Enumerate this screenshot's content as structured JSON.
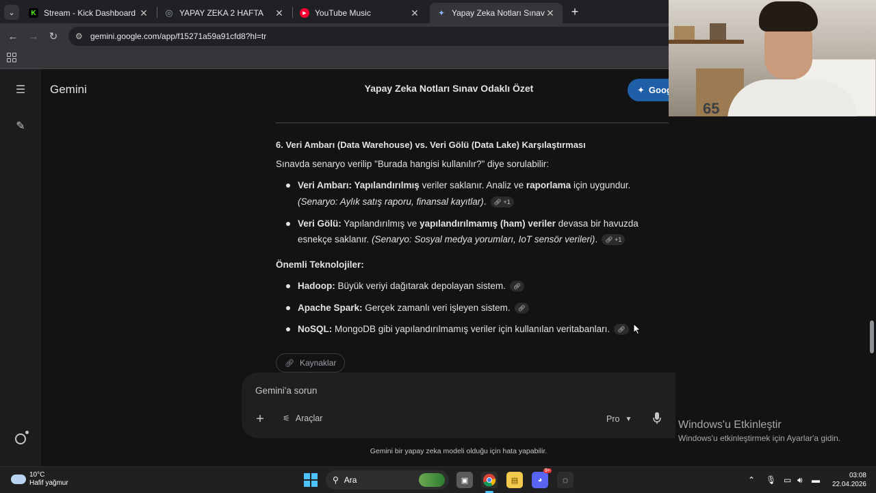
{
  "browser": {
    "tabs": [
      {
        "title": "Stream - Kick Dashboard",
        "favicon": "K",
        "favicon_color": "#53fc18",
        "active": false
      },
      {
        "title": "YAPAY ZEKA 2 HAFTA",
        "favicon": "◎",
        "favicon_color": "#9aa0a6",
        "active": false
      },
      {
        "title": "YouTube Music",
        "favicon": "▶",
        "favicon_color": "#ff0033",
        "active": false
      },
      {
        "title": "Yapay Zeka Notları Sınav Odakl",
        "favicon": "✦",
        "favicon_color": "#8ab4f8",
        "active": true
      }
    ],
    "url": "gemini.google.com/app/f15271a59a91cfd8?hl=tr"
  },
  "gemini": {
    "brand": "Gemini",
    "conversation_title": "Yapay Zeka Notları Sınav Odaklı Özet",
    "google_button": "Goog",
    "section_heading": "6. Veri Ambarı (Data Warehouse) vs. Veri Gölü (Data Lake) Karşılaştırması",
    "intro": "Sınavda senaryo verilip \"Burada hangisi kullanılır?\" diye sorulabilir:",
    "bullets1": [
      {
        "line1": {
          "b1": "Veri Ambarı: Yapılandırılmış",
          "t1": " veriler saklanır. Analiz ve ",
          "b2": "raporlama",
          "t2": " için uygundur."
        },
        "line2": {
          "i1": "(Senaryo: Aylık satış raporu, finansal kayıtlar)",
          "t1": ".",
          "cite": "+1"
        }
      },
      {
        "line1": {
          "b1": "Veri Gölü:",
          "t1": " Yapılandırılmış ve ",
          "b2": "yapılandırılmamış (ham) veriler",
          "t2": " devasa bir havuzda"
        },
        "line2": {
          "t0": "esnekçe saklanır. ",
          "i1": "(Senaryo: Sosyal medya yorumları, IoT sensör verileri)",
          "t1": ".",
          "cite": "+1"
        }
      }
    ],
    "tech_heading": "Önemli Teknolojiler:",
    "bullets2": [
      {
        "b": "Hadoop:",
        "t": " Büyük veriyi dağıtarak depolayan sistem."
      },
      {
        "b": "Apache Spark:",
        "t": " Gerçek zamanlı veri işleyen sistem."
      },
      {
        "b": "NoSQL:",
        "t": " MongoDB gibi yapılandırılmamış veriler için kullanılan veritabanları."
      }
    ],
    "sources_label": "Kaynaklar",
    "composer": {
      "placeholder": "Gemini'a sorun",
      "tools_label": "Araçlar",
      "model_label": "Pro"
    },
    "disclaimer": "Gemini bir yapay zeka modeli olduğu için hata yapabilir."
  },
  "activation": {
    "title": "Windows'u Etkinleştir",
    "subtitle": "Windows'u etkinleştirmek için Ayarlar'a gidin."
  },
  "webcam": {
    "overlay_text": "65"
  },
  "taskbar": {
    "temperature": "10°C",
    "weather": "Hafif yağmur",
    "search_label": "Ara",
    "time": "03:08",
    "date": "22.04.2026",
    "discord_badge": "9+"
  }
}
